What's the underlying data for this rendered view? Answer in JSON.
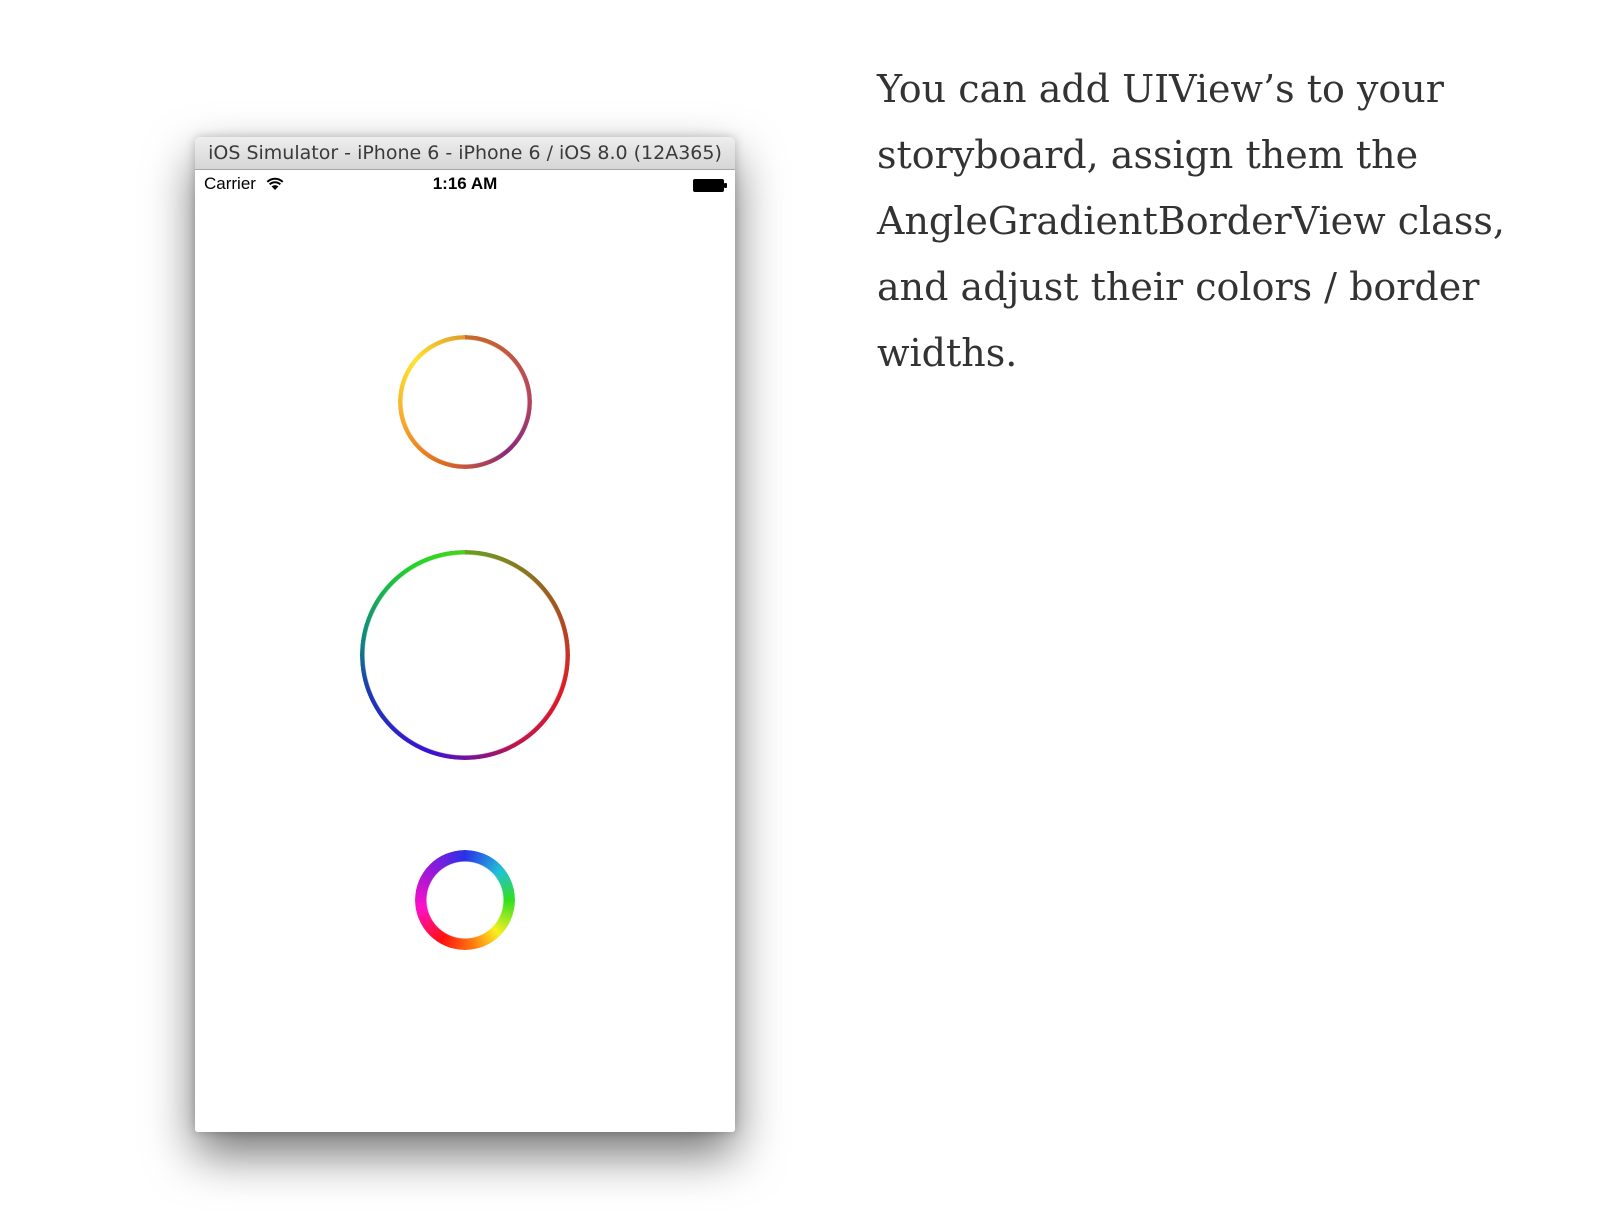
{
  "simulator": {
    "title": "iOS Simulator - iPhone 6 - iPhone 6 / iOS 8.0 (12A365)"
  },
  "status_bar": {
    "carrier": "Carrier",
    "time": "1:16 AM",
    "wifi_icon": "wifi-icon",
    "battery_icon": "battery-icon"
  },
  "rings": [
    {
      "name": "small-warm-ring",
      "colors": [
        "#fce431",
        "#f7a52a",
        "#e06a20",
        "#b8485a",
        "#8a2a7a"
      ]
    },
    {
      "name": "large-spectrum-ring",
      "colors": [
        "#22d428",
        "#a05820",
        "#e01a28",
        "#3a10d8",
        "#108a80"
      ]
    },
    {
      "name": "thick-rainbow-ring",
      "colors": [
        "#2a30e8",
        "#30e020",
        "#f8f020",
        "#ff1010",
        "#ff10c8"
      ]
    }
  ],
  "article": {
    "paragraph": "You can add UIView’s to your storyboard, assign them the AngleGradientBorderView class, and adjust their colors / border widths."
  }
}
